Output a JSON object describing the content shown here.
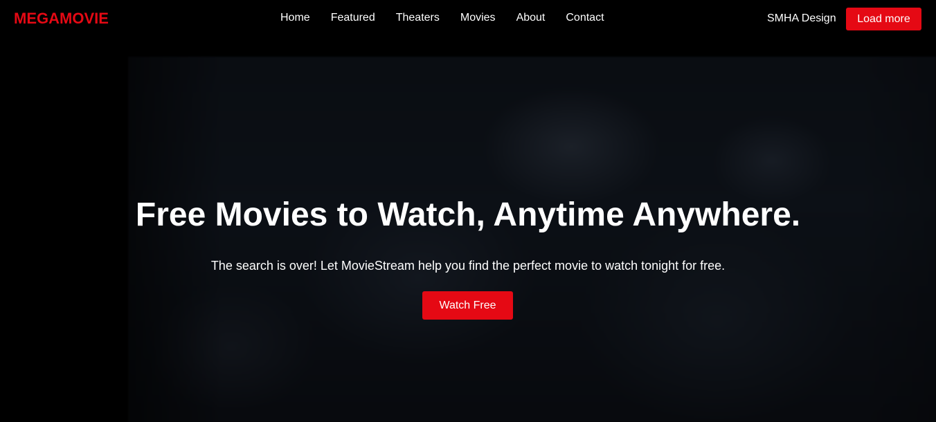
{
  "brand": {
    "name": "MEGAMOVIE",
    "accent_color": "#e50914"
  },
  "nav": {
    "links": [
      "Home",
      "Featured",
      "Theaters",
      "Movies",
      "About",
      "Contact"
    ]
  },
  "header_right": {
    "designer_label": "SMHA Design",
    "load_more_label": "Load more"
  },
  "hero": {
    "title": "Free Movies to Watch, Anytime Anywhere.",
    "subtitle": "The search is over! Let MovieStream help you find the perfect movie to watch tonight for free.",
    "cta_label": "Watch Free"
  }
}
